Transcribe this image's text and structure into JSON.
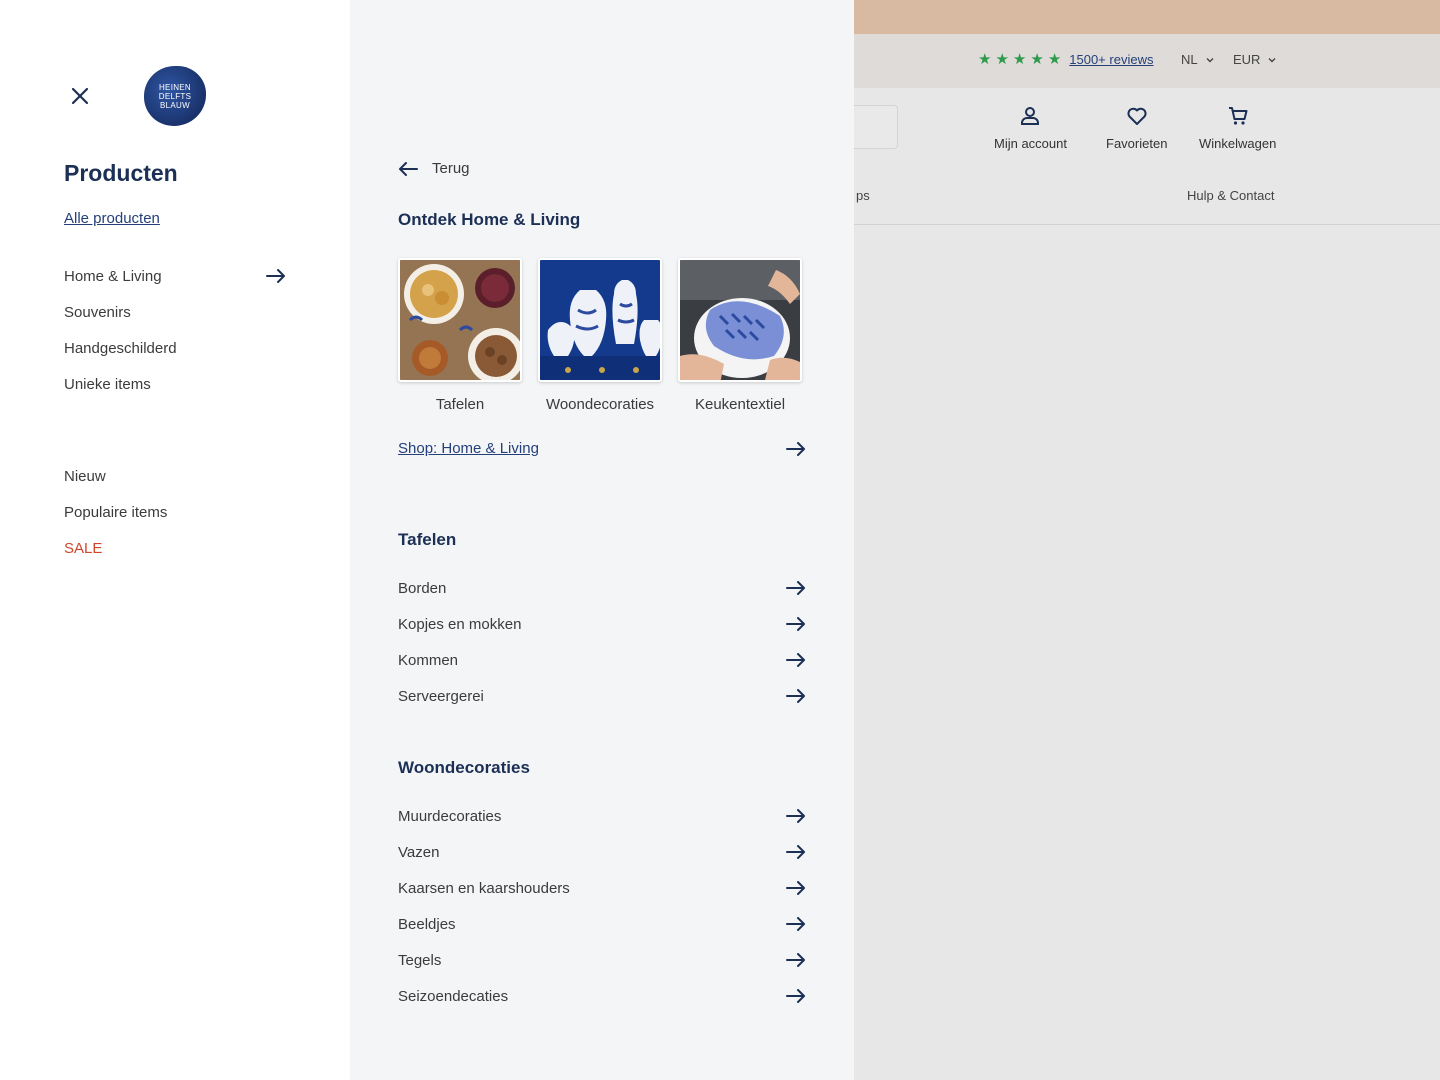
{
  "background": {
    "stars": [
      "★",
      "★",
      "★",
      "★",
      "★"
    ],
    "reviews_link": "1500+ reviews",
    "language": "NL",
    "currency": "EUR",
    "nav": {
      "account": "Mijn account",
      "favorites": "Favorieten",
      "cart": "Winkelwagen"
    },
    "partial_link": "ps",
    "help_link": "Hulp & Contact"
  },
  "left_drawer": {
    "logo_lines": [
      "HEINEN",
      "DELFTS",
      "BLAUW"
    ],
    "title": "Producten",
    "all_products": "Alle producten",
    "primary_items": [
      {
        "label": "Home & Living",
        "has_arrow": true
      },
      {
        "label": "Souvenirs"
      },
      {
        "label": "Handgeschilderd"
      },
      {
        "label": "Unieke items"
      }
    ],
    "secondary_items": [
      {
        "label": "Nieuw"
      },
      {
        "label": "Populaire items"
      },
      {
        "label": "SALE"
      }
    ]
  },
  "mid_panel": {
    "back": "Terug",
    "discover_title": "Ontdek Home & Living",
    "tiles": [
      {
        "label": "Tafelen"
      },
      {
        "label": "Woondecoraties"
      },
      {
        "label": "Keukentextiel"
      }
    ],
    "shop_link": "Shop: Home & Living",
    "tafelen": {
      "title": "Tafelen",
      "items": [
        "Borden",
        "Kopjes en mokken",
        "Kommen",
        "Serveergerei"
      ]
    },
    "woondecoraties": {
      "title": "Woondecoraties",
      "items": [
        "Muurdecoraties",
        "Vazen",
        "Kaarsen en kaarshouders",
        "Beeldjes",
        "Tegels",
        "Seizoendecaties"
      ]
    }
  },
  "colors": {
    "brand_navy": "#1c2f55",
    "link_blue": "#243f7a",
    "sale_red": "#d0452c",
    "star_green": "#2f9a4c"
  }
}
